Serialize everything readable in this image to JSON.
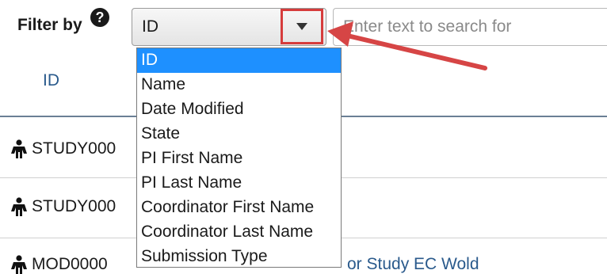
{
  "filter": {
    "label": "Filter by",
    "help_symbol": "?",
    "selected_value": "ID",
    "search_placeholder": "Enter text to search for"
  },
  "table": {
    "column_header": "ID",
    "rows": [
      {
        "id_text": "STUDY000"
      },
      {
        "id_text": "STUDY000"
      },
      {
        "id_text": "MOD0000",
        "link_text": "or Study EC Wold"
      }
    ]
  },
  "dropdown": {
    "options": [
      "ID",
      "Name",
      "Date Modified",
      "State",
      "PI First Name",
      "PI Last Name",
      "Coordinator First Name",
      "Coordinator Last Name",
      "Submission Type"
    ],
    "selected_index": 0
  },
  "colors": {
    "highlight_border": "#d63c3c",
    "selected_option": "#1e90ff",
    "link": "#2a5a8c"
  },
  "icons": {
    "help": "question-circle-icon",
    "dropdown_toggle": "caret-down-icon",
    "row_type": "person-icon",
    "annotation": "pointer-arrow"
  }
}
